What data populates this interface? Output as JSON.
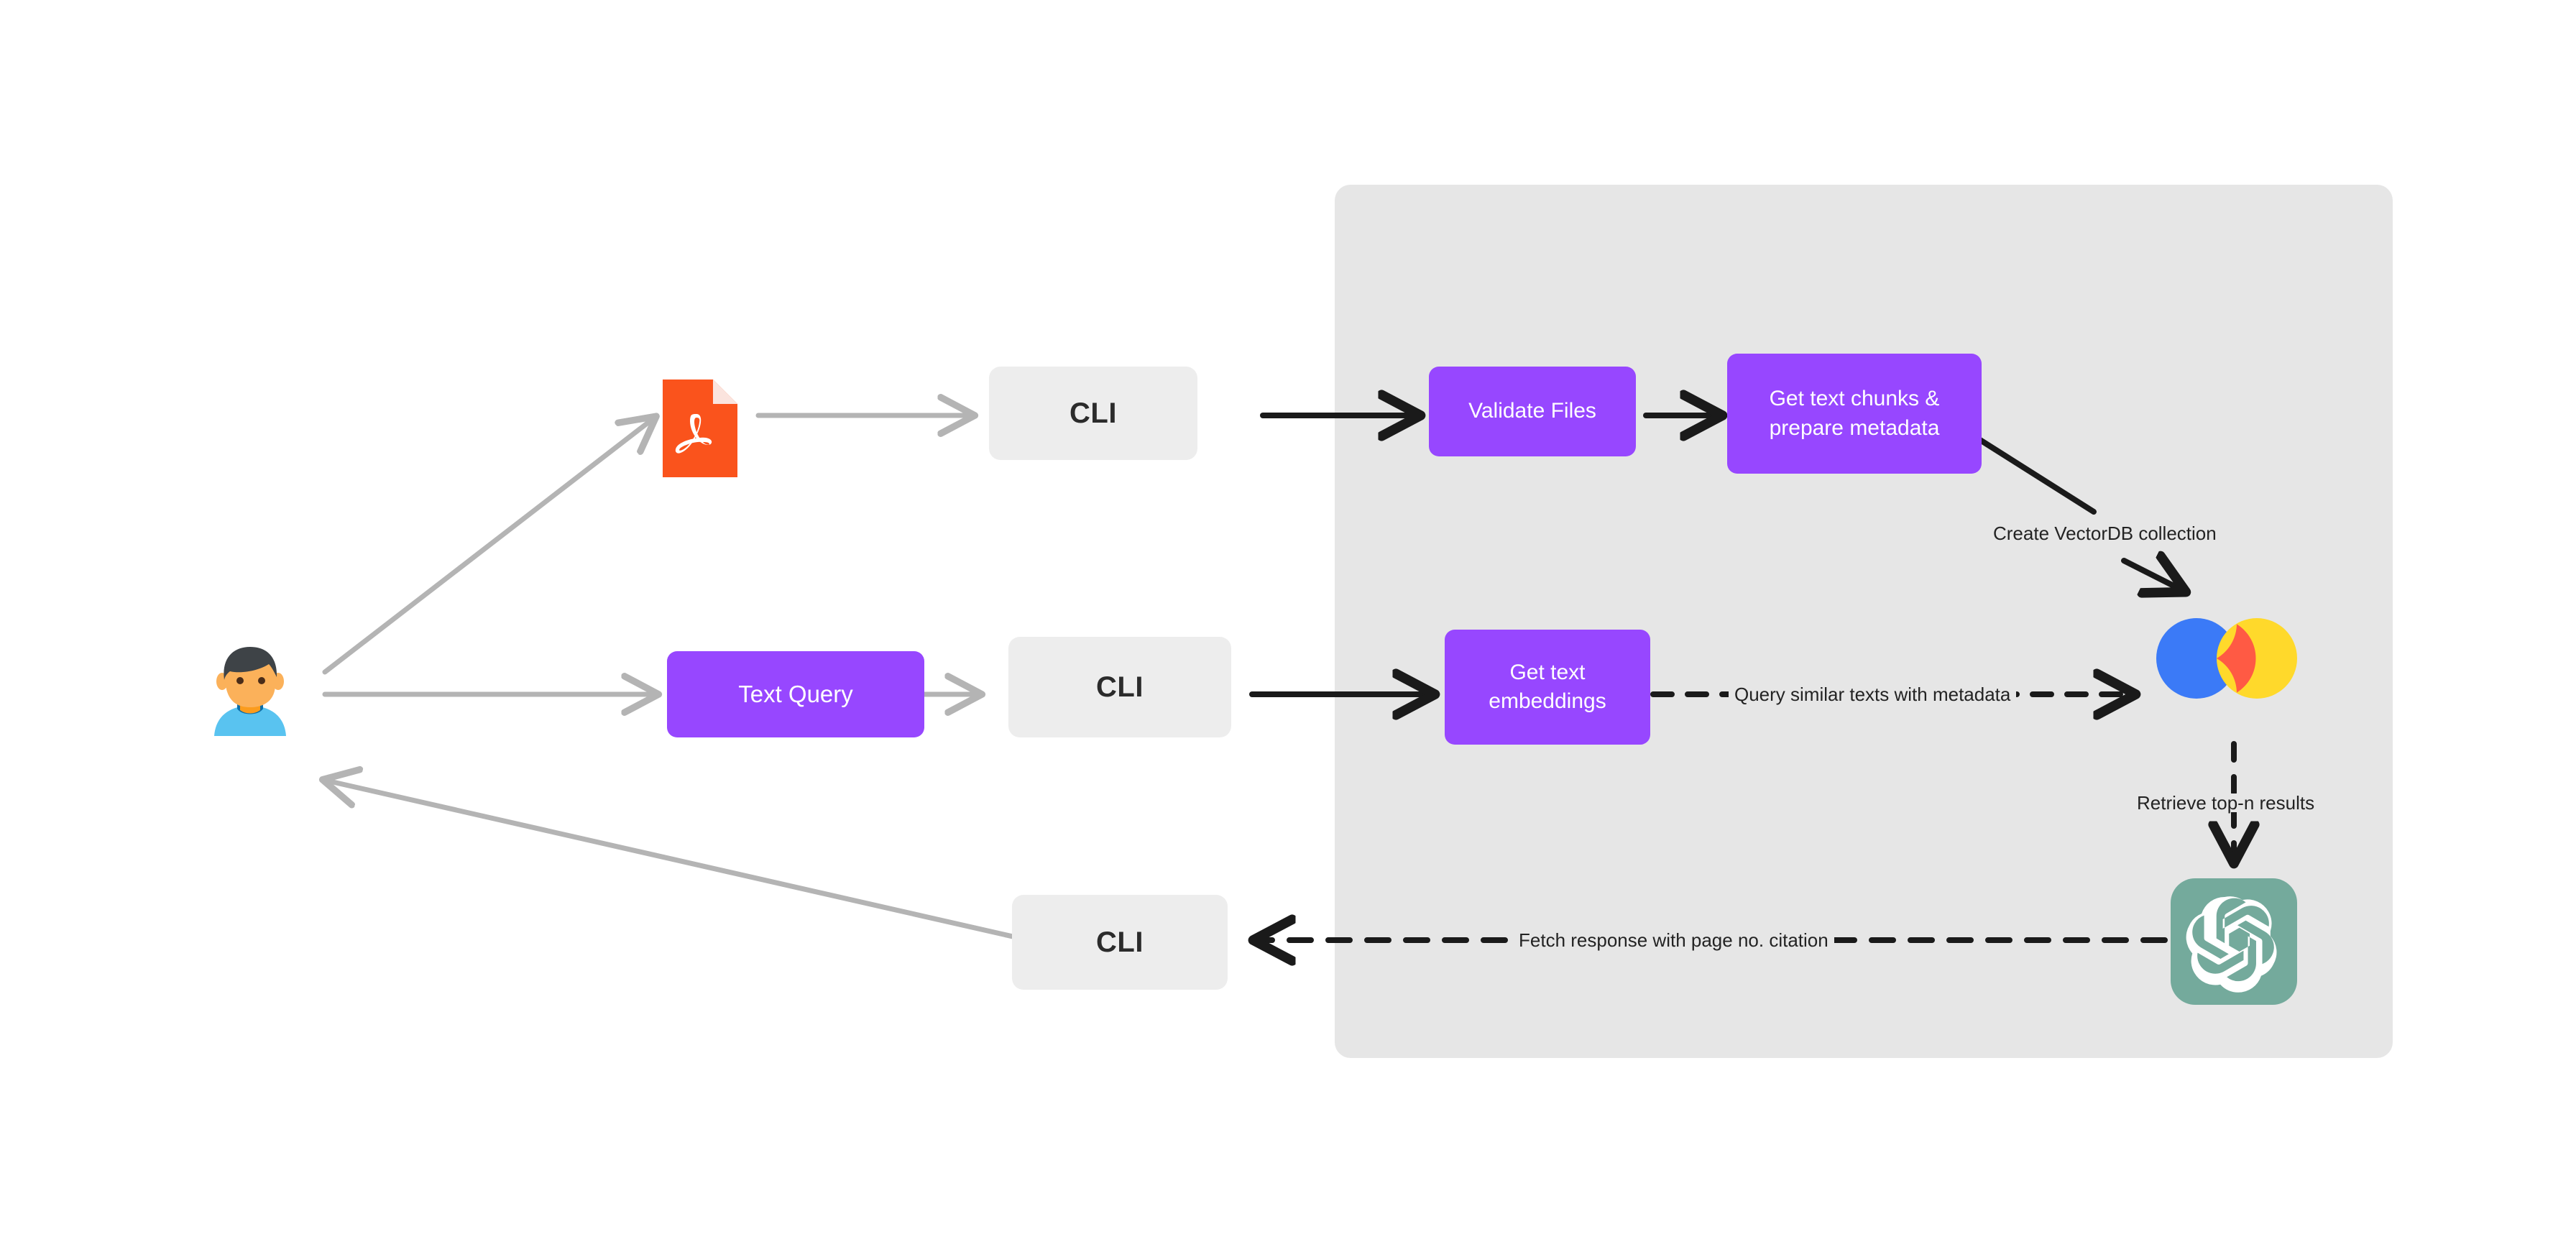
{
  "diagram": {
    "title": "RAG CLI Architecture Flow",
    "background_color": "#FFFFFF",
    "panel_color": "#E6E6E6",
    "accent_purple": "#9747FF",
    "cli_box_color": "#EDEDED",
    "pdf_orange": "#FA531C",
    "chroma_blue": "#3B7AF7",
    "chroma_red": "#FF5A44",
    "chroma_yellow": "#FFD92B",
    "openai_green": "#74AA9C",
    "arrow_gray": "#B4B4B4",
    "arrow_black": "#1A1A1A"
  },
  "actors": {
    "user": {
      "icon": "user-avatar-icon",
      "label": ""
    }
  },
  "inputs": {
    "pdf": {
      "icon": "pdf-file-icon",
      "label": ""
    },
    "text_query": {
      "label": "Text Query"
    }
  },
  "cli": {
    "top": {
      "label": "CLI"
    },
    "middle": {
      "label": "CLI"
    },
    "bottom": {
      "label": "CLI"
    }
  },
  "backend": {
    "steps": [
      {
        "id": "validate-files",
        "label": "Validate Files"
      },
      {
        "id": "get-text-chunks",
        "label": "Get text chunks &\nprepare metadata"
      },
      {
        "id": "get-text-embeddings",
        "label": "Get text\nembeddings"
      }
    ],
    "services": [
      {
        "id": "vector-db",
        "name": "chroma-vectordb-logo"
      },
      {
        "id": "llm",
        "name": "openai-logo"
      }
    ]
  },
  "edges": [
    {
      "id": "create-vectordb-collection",
      "label": "Create VectorDB collection",
      "style": "solid",
      "color": "#1A1A1A"
    },
    {
      "id": "query-similar-texts",
      "label": "Query similar texts with metadata",
      "style": "dashed",
      "color": "#1A1A1A"
    },
    {
      "id": "retrieve-top-n",
      "label": "Retrieve top-n results",
      "style": "dashed",
      "color": "#1A1A1A"
    },
    {
      "id": "fetch-response",
      "label": "Fetch response with page no. citation",
      "style": "dashed",
      "color": "#1A1A1A"
    }
  ]
}
